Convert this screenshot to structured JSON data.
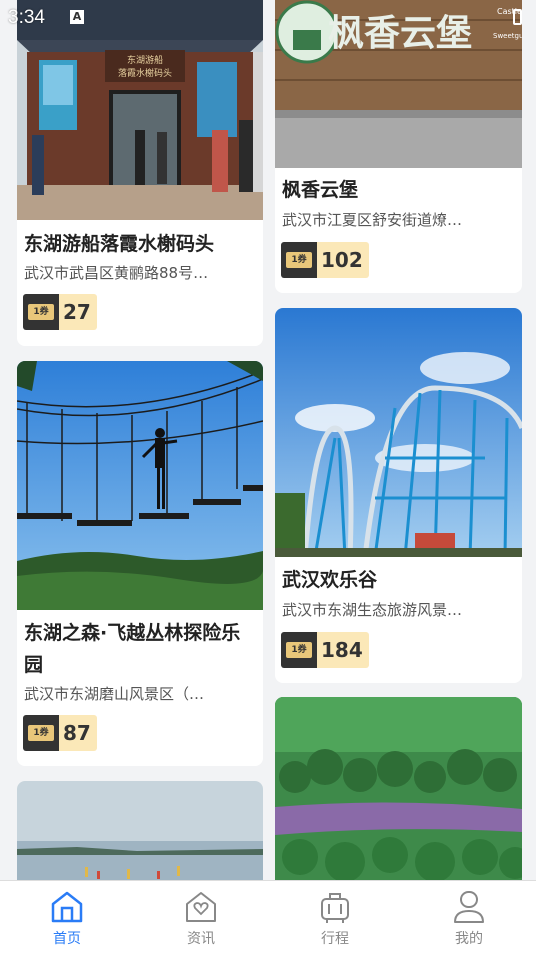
{
  "status_bar": {
    "time": "3:34",
    "notif": "A"
  },
  "cards": [
    {
      "title": "东湖游船落霞水榭码头",
      "address": "武汉市武昌区黄鹂路88号…",
      "price": "27",
      "ticket_label": "1券"
    },
    {
      "title": "枫香云堡",
      "address": "武汉市江夏区舒安街道燎…",
      "price": "102",
      "ticket_label": "1券"
    },
    {
      "title": "东湖之森·飞越丛林探险乐园",
      "address": "武汉市东湖磨山风景区（…",
      "price": "87",
      "ticket_label": "1券"
    },
    {
      "title": "武汉欢乐谷",
      "address": "武汉市东湖生态旅游风景…",
      "price": "184",
      "ticket_label": "1券"
    },
    {
      "title": "",
      "address": "",
      "price": "",
      "ticket_label": ""
    },
    {
      "title": "",
      "address": "",
      "price": "",
      "ticket_label": ""
    }
  ],
  "sign_text": {
    "line1": "东湖游船",
    "line2": "落霞水榭码头",
    "fengxiang": "枫香云堡",
    "castle": "Castle",
    "sweet": "Sweetgum"
  },
  "tabs": [
    {
      "label": "首页",
      "icon": "home-icon",
      "active": true
    },
    {
      "label": "资讯",
      "icon": "news-icon",
      "active": false
    },
    {
      "label": "行程",
      "icon": "luggage-icon",
      "active": false
    },
    {
      "label": "我的",
      "icon": "profile-icon",
      "active": false
    }
  ],
  "colors": {
    "accent": "#2a7cf6",
    "badge_bg": "#fbe8b8",
    "ticket_dark": "#333333"
  }
}
